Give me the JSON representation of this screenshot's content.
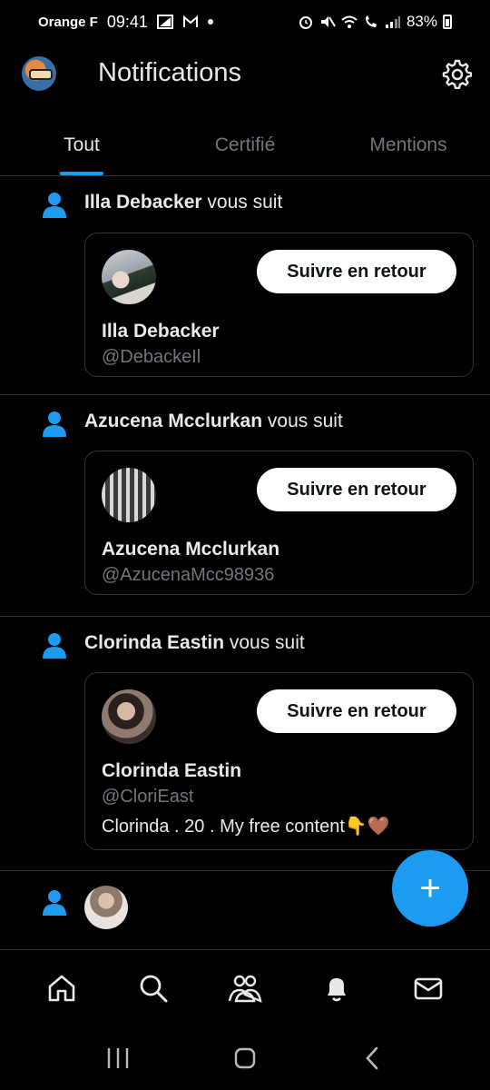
{
  "status_bar": {
    "carrier": "Orange F",
    "time": "09:41",
    "battery": "83%"
  },
  "header": {
    "title": "Notifications"
  },
  "tabs": [
    {
      "label": "Tout",
      "active": true
    },
    {
      "label": "Certifié",
      "active": false
    },
    {
      "label": "Mentions",
      "active": false
    }
  ],
  "notifications": [
    {
      "name": "Illa Debacker",
      "action": " vous suit",
      "card": {
        "name": "Illa Debacker",
        "handle": "@DebackeIl",
        "button": "Suivre en retour"
      }
    },
    {
      "name": "Azucena Mcclurkan",
      "action": " vous suit",
      "card": {
        "name": "Azucena Mcclurkan",
        "handle": "@AzucenaMcc98936",
        "button": "Suivre en retour"
      }
    },
    {
      "name": "Clorinda Eastin",
      "action": " vous suit",
      "card": {
        "name": "Clorinda Eastin",
        "handle": "@CloriEast",
        "bio": "Clorinda . 20 . My free content👇🤎",
        "button": "Suivre en retour"
      }
    }
  ],
  "fab_label": "+",
  "bottom_nav": [
    "home-icon",
    "search-icon",
    "communities-icon",
    "notifications-icon",
    "messages-icon"
  ],
  "colors": {
    "accent": "#1d9bf0",
    "background": "#000000",
    "secondary_text": "#71767b",
    "divider": "#2f3336"
  }
}
